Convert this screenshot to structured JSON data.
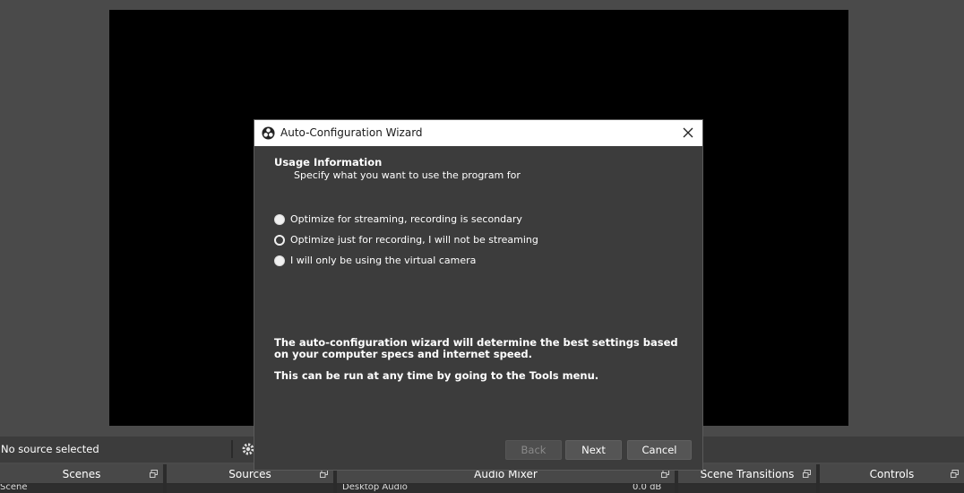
{
  "dialog": {
    "title": "Auto-Configuration Wizard",
    "heading": "Usage Information",
    "subheading": "Specify what you want to use the program for",
    "options": [
      {
        "label": "Optimize for streaming, recording is secondary",
        "selected": false
      },
      {
        "label": "Optimize just for recording, I will not be streaming",
        "selected": true
      },
      {
        "label": "I will only be using the virtual camera",
        "selected": false
      }
    ],
    "info_1": "The auto-configuration wizard will determine the best settings based on your computer specs and internet speed.",
    "info_2": "This can be run at any time by going to the Tools menu.",
    "back_label": "Back",
    "next_label": "Next",
    "cancel_label": "Cancel"
  },
  "source_bar": {
    "no_source": "No source selected"
  },
  "docks": {
    "scenes": "Scenes",
    "sources": "Sources",
    "audio_mixer": "Audio Mixer",
    "scene_transitions": "Scene Transitions",
    "controls": "Controls",
    "scene_item": "Scene",
    "audio_item": "Desktop Audio",
    "audio_level": "0.0 dB"
  },
  "colors": {
    "accent": "#ffffff",
    "dialog_bg": "#3c3c3c",
    "window_bg": "#4a4a4a"
  }
}
